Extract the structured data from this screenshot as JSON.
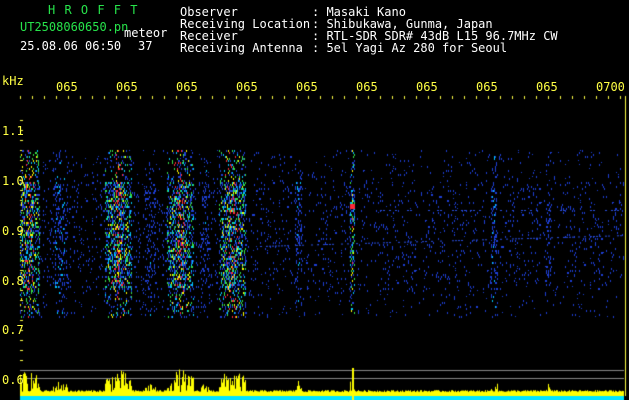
{
  "header": {
    "app_title": "H R O F F T",
    "file_name": "UT2508060650.pn",
    "type_label": "meteor",
    "timestamp": "25.08.06 06:50",
    "count": "37",
    "fields": [
      {
        "label": "Observer",
        "value": ": Masaki Kano"
      },
      {
        "label": "Receiving Location",
        "value": ": Shibukawa, Gunma, Japan"
      },
      {
        "label": "Receiver",
        "value": ": RTL-SDR SDR# 43dB L15 96.7MHz CW"
      },
      {
        "label": "Receiving Antenna",
        "value": ": 5el Yagi Az 280 for Seoul"
      }
    ]
  },
  "axis": {
    "y_unit": "kHz",
    "y_ticks": [
      "1.1",
      "1.0",
      "0.9",
      "0.8",
      "0.7",
      "0.6"
    ],
    "x_ticks": [
      "065",
      "065",
      "065",
      "065",
      "065",
      "065",
      "065",
      "065",
      "065",
      "0700"
    ]
  },
  "colors": {
    "background": "#000000",
    "axis_text": "#ffff44",
    "title": "#27e34b",
    "bars": "#ffff00",
    "floor": "#00e5ff"
  }
}
